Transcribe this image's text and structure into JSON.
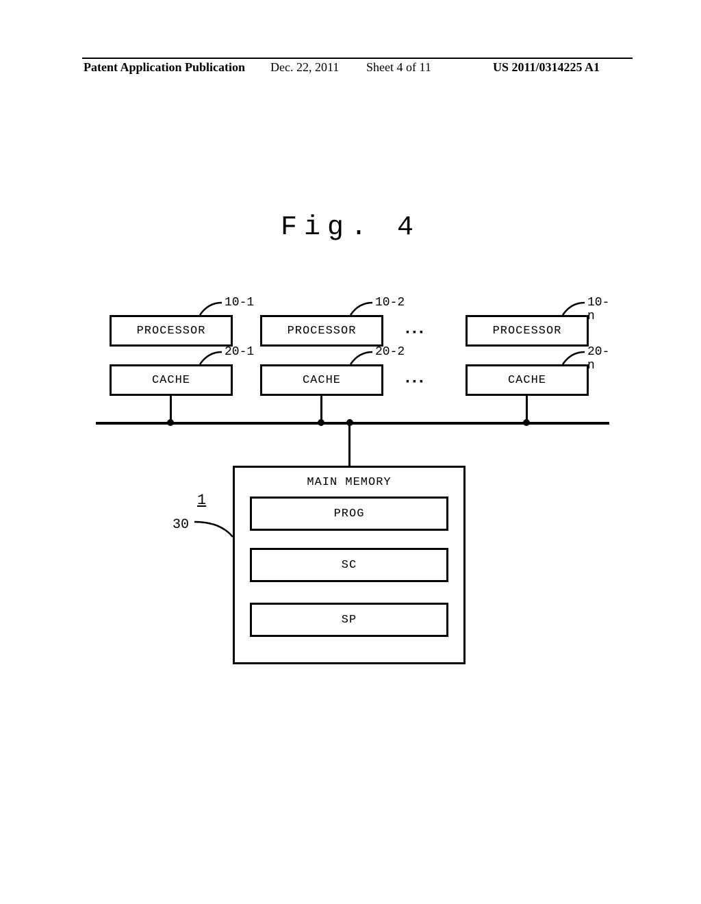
{
  "header": {
    "pub_type": "Patent Application Publication",
    "date": "Dec. 22, 2011",
    "sheet": "Sheet 4 of 11",
    "pub_number": "US 2011/0314225 A1"
  },
  "figure": {
    "title": "Fig. 4"
  },
  "labels": {
    "proc_1": "10-1",
    "proc_2": "10-2",
    "proc_n": "10-n",
    "cache_1": "20-1",
    "cache_2": "20-2",
    "cache_n": "20-n",
    "system": "1",
    "memory": "30"
  },
  "boxes": {
    "processor": "PROCESSOR",
    "cache": "CACHE",
    "main_memory": "MAIN MEMORY",
    "prog": "PROG",
    "sc": "SC",
    "sp": "SP"
  },
  "misc": {
    "ellipsis": "···"
  },
  "chart_data": {
    "type": "diagram",
    "title": "Fig. 4",
    "description": "Multiprocessor system block diagram: n processors (10-1..10-n) each with a cache (20-1..20-n) connected via a shared bus to a main memory (30) containing PROG, SC, and SP regions. System labeled 1.",
    "components": [
      {
        "id": "10-1",
        "type": "PROCESSOR"
      },
      {
        "id": "10-2",
        "type": "PROCESSOR"
      },
      {
        "id": "10-n",
        "type": "PROCESSOR"
      },
      {
        "id": "20-1",
        "type": "CACHE",
        "attached_to": "10-1"
      },
      {
        "id": "20-2",
        "type": "CACHE",
        "attached_to": "10-2"
      },
      {
        "id": "20-n",
        "type": "CACHE",
        "attached_to": "10-n"
      },
      {
        "id": "30",
        "type": "MAIN MEMORY",
        "contains": [
          "PROG",
          "SC",
          "SP"
        ]
      }
    ],
    "bus_connects": [
      "20-1",
      "20-2",
      "20-n",
      "30"
    ],
    "system_ref": "1"
  }
}
